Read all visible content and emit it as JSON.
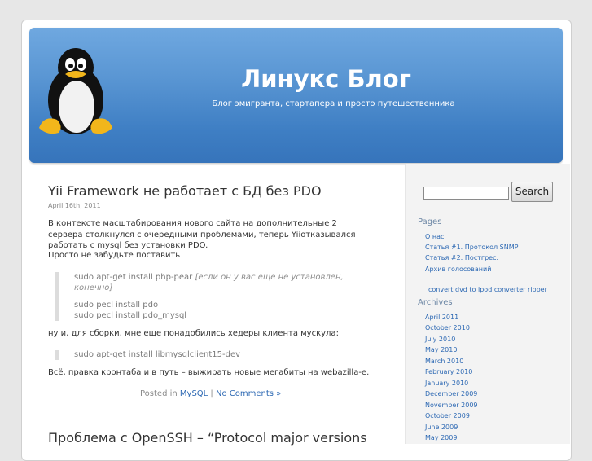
{
  "header": {
    "title": "Линукс Блог",
    "tagline": "Блог эмигранта, стартапера и просто путешественника"
  },
  "sidebar": {
    "search_button": "Search",
    "search_value": "",
    "pages_heading": "Pages",
    "pages": [
      "О нас",
      "Статья #1. Протокол SNMP",
      "Статья #2: Постгрес.",
      "Архив голосований"
    ],
    "promo_link": "convert dvd to ipod converter ripper",
    "archives_heading": "Archives",
    "archives": [
      "April 2011",
      "October 2010",
      "July 2010",
      "May 2010",
      "March 2010",
      "February 2010",
      "January 2010",
      "December 2009",
      "November 2009",
      "October 2009",
      "June 2009",
      "May 2009"
    ]
  },
  "post": {
    "title": "Yii Framework не работает с БД без PDO",
    "date": "April 16th, 2011",
    "para1_line1": "В контексте масштабирования нового сайта на дополнительные   2",
    "para1_line2": "сервера столкнулся с очередными проблемами, теперь  Yiiотказывался",
    "para1_line3": "работать с mysql без установки PDO.",
    "para1_line4": "Просто не забудьте поставить",
    "code1_line1": "sudo apt-get install php-pear ",
    "code1_note1": "[если он у вас еще не установлен,",
    "code1_note2": "конечно]",
    "code1_line2": "sudo pecl install pdo",
    "code1_line3": "sudo pecl install pdo_mysql",
    "para2": "ну и, для сборки, мне еще понадобились хедеры клиента мускула:",
    "code2": "sudo apt-get install libmysqlclient15-dev",
    "para3": "Всё, правка кронтаба и в путь – выжирать новые мегабиты на webazilla-e.",
    "posted_in": "Posted in ",
    "category": "MySQL",
    "separator": " | ",
    "comments": "No Comments »"
  },
  "post2": {
    "title": "Проблема с OpenSSH – “Protocol major versions"
  }
}
